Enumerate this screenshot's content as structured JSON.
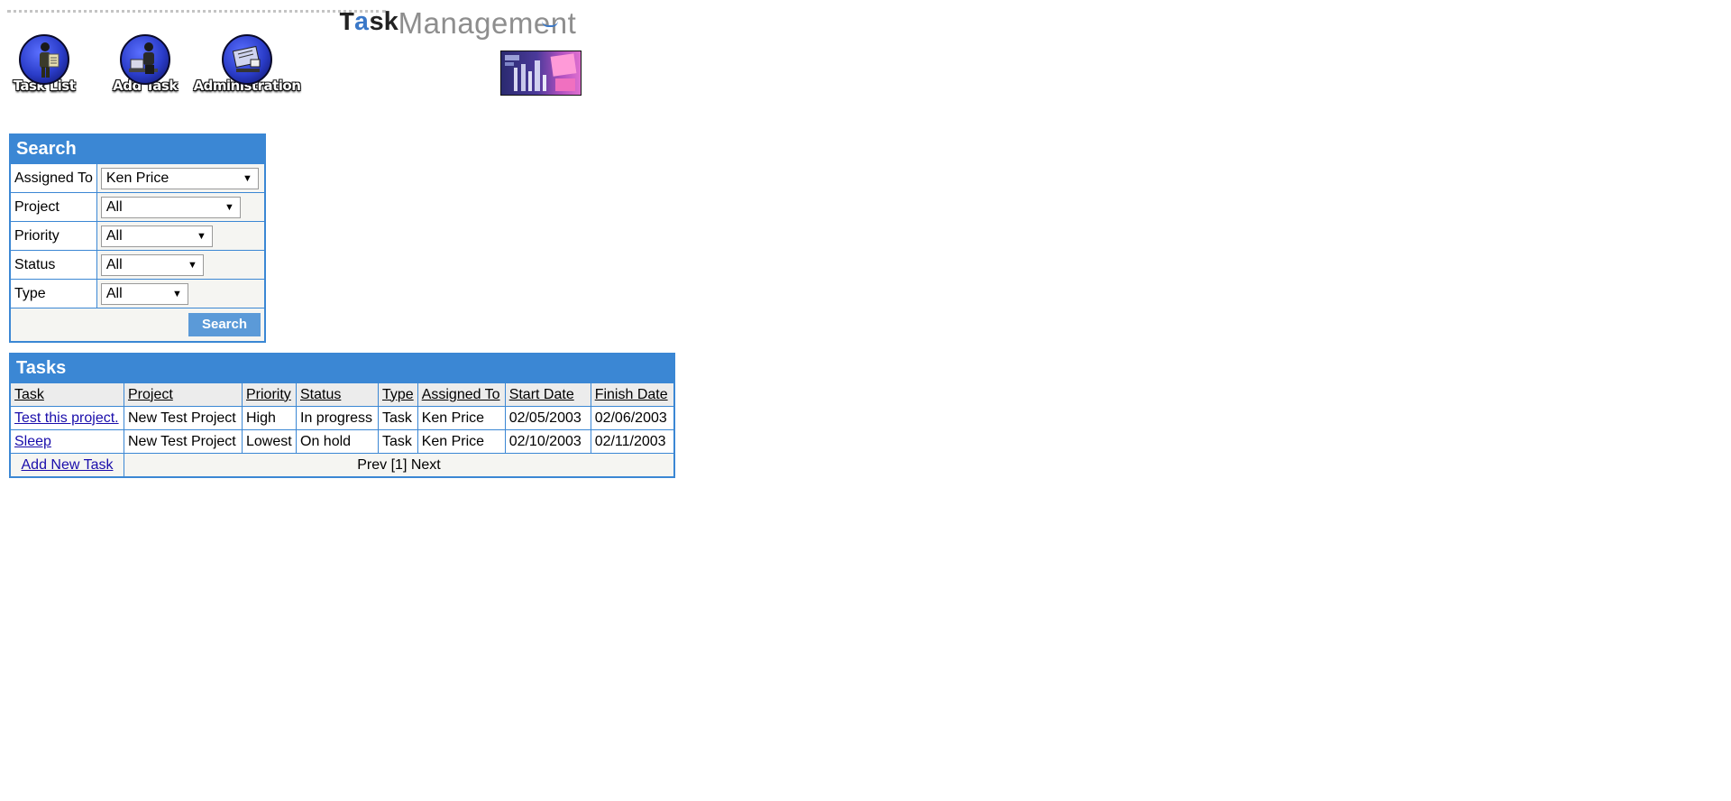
{
  "header": {
    "logo": {
      "part1": "T",
      "part2": "a",
      "part3": "sk",
      "part4": "Management"
    },
    "nav": [
      {
        "label": "Task List",
        "icon": "person-list-icon"
      },
      {
        "label": "Add Task",
        "icon": "person-computer-icon"
      },
      {
        "label": "Administration",
        "icon": "admin-desk-icon"
      }
    ],
    "banner_icon": "skyline-graphic-icon"
  },
  "search": {
    "title": "Search",
    "fields": [
      {
        "label": "Assigned To",
        "value": "Ken Price"
      },
      {
        "label": "Project",
        "value": "All"
      },
      {
        "label": "Priority",
        "value": "All"
      },
      {
        "label": "Status",
        "value": "All"
      },
      {
        "label": "Type",
        "value": "All"
      }
    ],
    "button_label": "Search"
  },
  "tasks": {
    "title": "Tasks",
    "columns": [
      "Task",
      "Project",
      "Priority",
      "Status",
      "Type",
      "Assigned To",
      "Start Date",
      "Finish Date"
    ],
    "rows": [
      [
        "Test this project.",
        "New Test Project",
        "High",
        "In progress",
        "Task",
        "Ken Price",
        "02/05/2003",
        "02/06/2003"
      ],
      [
        "Sleep",
        "New Test Project",
        "Lowest",
        "On hold",
        "Task",
        "Ken Price",
        "02/10/2003",
        "02/11/2003"
      ]
    ],
    "add_link": "Add New Task",
    "pager": {
      "prev": "Prev",
      "page": "[1]",
      "next": "Next"
    }
  },
  "colors": {
    "accent": "#3b87d4",
    "button": "#5b9ad8",
    "link": "#1a0dab"
  }
}
